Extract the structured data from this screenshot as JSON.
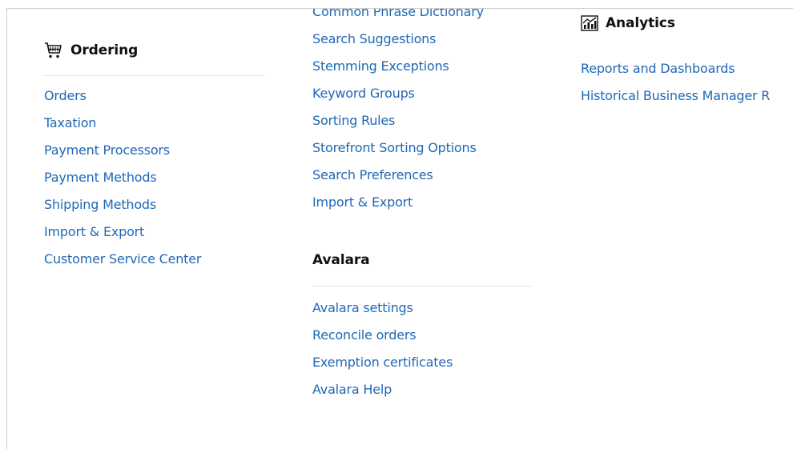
{
  "ordering": {
    "icon": "shopping-cart-icon",
    "title": "Ordering",
    "links": [
      "Orders",
      "Taxation",
      "Payment Processors",
      "Payment Methods",
      "Shipping Methods",
      "Import & Export",
      "Customer Service Center"
    ]
  },
  "search": {
    "links": [
      "Common Phrase Dictionary",
      "Search Suggestions",
      "Stemming Exceptions",
      "Keyword Groups",
      "Sorting Rules",
      "Storefront Sorting Options",
      "Search Preferences",
      "Import & Export"
    ]
  },
  "avalara": {
    "title": "Avalara",
    "links": [
      "Avalara settings",
      "Reconcile orders",
      "Exemption certificates",
      "Avalara Help"
    ]
  },
  "analytics": {
    "icon": "analytics-chart-icon",
    "title": "Analytics",
    "links": [
      "Reports and Dashboards",
      "Historical Business Manager R"
    ]
  },
  "colors": {
    "link": "#1f68b6",
    "heading": "#111111",
    "divider": "#e6e6e6"
  }
}
